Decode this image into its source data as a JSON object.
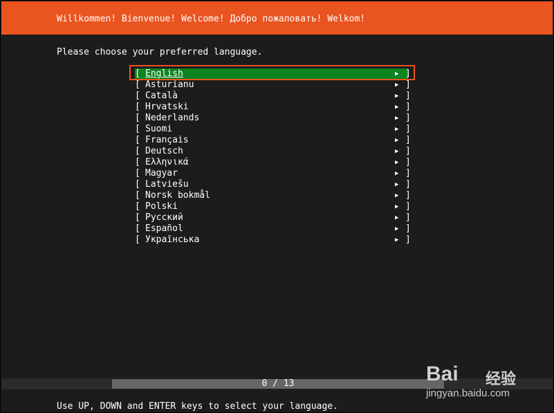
{
  "header": {
    "title": "Willkommen! Bienvenue! Welcome! Добро пожаловать! Welkom!"
  },
  "prompt": "Please choose your preferred language.",
  "languages": [
    "English",
    "Asturianu",
    "Català",
    "Hrvatski",
    "Nederlands",
    "Suomi",
    "Français",
    "Deutsch",
    "Ελληνικά",
    "Magyar",
    "Latviešu",
    "Norsk bokmål",
    "Polski",
    "Русский",
    "Español",
    "Українська"
  ],
  "selected_index": 0,
  "bracket_open": "[",
  "bracket_close": "]",
  "arrow_glyph": "▶",
  "progress": {
    "text": "0 / 13"
  },
  "help": "Use UP, DOWN and ENTER keys to select your language.",
  "watermark": {
    "logo": "Bai",
    "cn": "经验",
    "url": "jingyan.baidu.com"
  },
  "colors": {
    "accent": "#e95420",
    "selected": "#0e8420",
    "background": "#1c1c1c"
  }
}
